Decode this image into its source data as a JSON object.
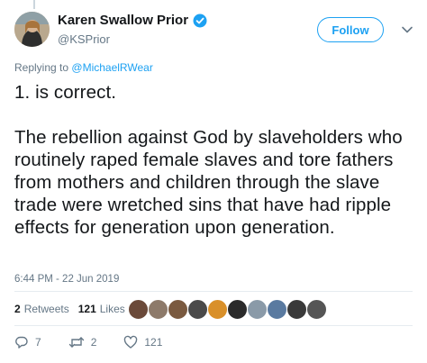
{
  "tweet": {
    "author": {
      "display_name": "Karen Swallow Prior",
      "handle": "@KSPrior",
      "verified": true,
      "verified_icon": "verified-badge-icon"
    },
    "follow_label": "Follow",
    "replying_prefix": "Replying to",
    "replying_to": "@MichaelRWear",
    "text_line1": "1. is correct.",
    "text_line2": "The rebellion against God by slaveholders who routinely raped female slaves and tore fathers from mothers and children through the slave trade were wretched sins that have had ripple effects for generation upon generation.",
    "timestamp": "6:44 PM - 22 Jun 2019",
    "retweets_count": "2",
    "retweets_label": "Retweets",
    "likes_count": "121",
    "likes_label": "Likes",
    "liker_avatars": [
      "#6b4a3a",
      "#8d7a6a",
      "#7a5a40",
      "#4a4a4a",
      "#d9902a",
      "#2b2b2b",
      "#8a9aa8",
      "#5a7aa0",
      "#3a3a3a",
      "#555555"
    ],
    "actions": {
      "reply_icon": "reply-icon",
      "reply_count": "7",
      "retweet_icon": "retweet-icon",
      "retweet_count": "2",
      "like_icon": "heart-icon",
      "like_count": "121"
    },
    "colors": {
      "accent": "#1da1f2",
      "secondary": "#657786",
      "text": "#14171a",
      "divider": "#e6ecf0"
    }
  }
}
